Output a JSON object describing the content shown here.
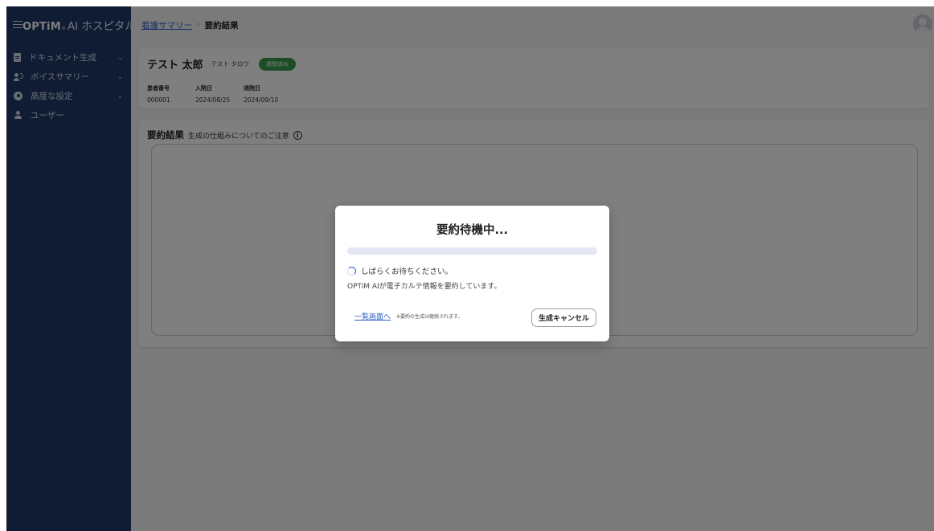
{
  "sidebar": {
    "brand_logo": "OPTiM",
    "brand_tm": "®",
    "brand_name": "AI ホスピタル",
    "items": [
      {
        "label": "ドキュメント生成",
        "icon": "document-icon",
        "expandable": true
      },
      {
        "label": "ボイスサマリー",
        "icon": "voice-icon",
        "expandable": true
      },
      {
        "label": "高度な設定",
        "icon": "gear-icon",
        "expandable": true
      },
      {
        "label": "ユーザー",
        "icon": "user-icon",
        "expandable": false
      }
    ],
    "chevron": "⌄"
  },
  "header": {
    "breadcrumb_link": "看護サマリー",
    "breadcrumb_sep": "›",
    "breadcrumb_current": "要約結果"
  },
  "patient": {
    "name": "テスト 太郎",
    "kana": "テスト タロウ",
    "status_badge": "退院済み",
    "fields": [
      {
        "label": "患者番号",
        "value": "000001"
      },
      {
        "label": "入院日",
        "value": "2024/08/25"
      },
      {
        "label": "退院日",
        "value": "2024/09/10"
      }
    ]
  },
  "summary": {
    "title": "要約結果",
    "note": "生成の仕組みについてのご注意",
    "info_glyph": "i"
  },
  "modal": {
    "title": "要約待機中...",
    "progress": 0,
    "status": "しばらくお待ちください。",
    "detail": "OPTiM AIが電子カルテ情報を要約しています。",
    "list_link": "一覧画面へ",
    "foot_note": "※要約の生成は継続されます。",
    "cancel_label": "生成キャンセル"
  },
  "colors": {
    "sidebar_bg": "#1f3869",
    "accent": "#2b5fc4",
    "badge_green": "#3a9a4d"
  }
}
